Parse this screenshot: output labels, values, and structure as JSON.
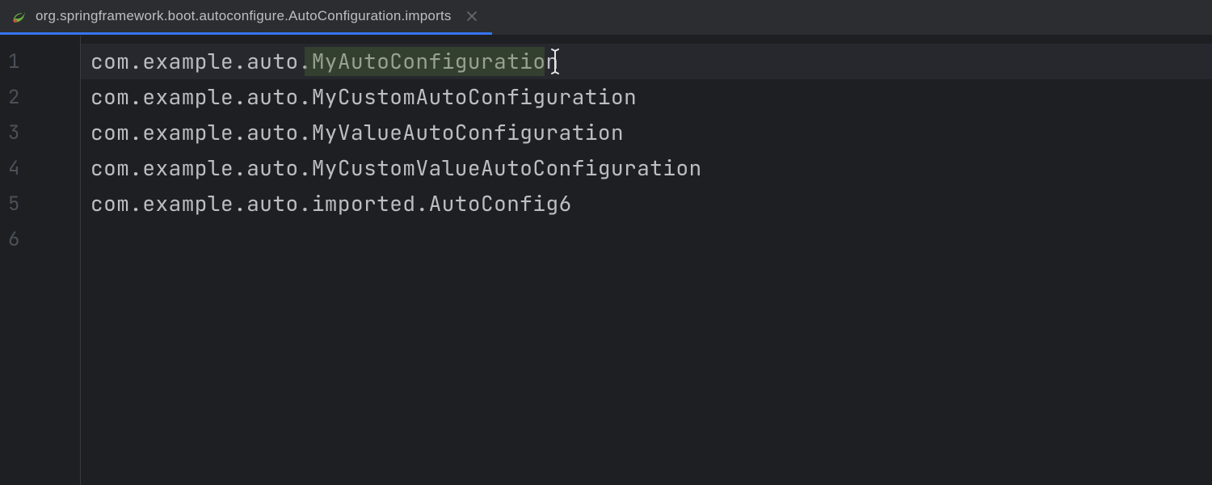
{
  "tab": {
    "title": "org.springframework.boot.autoconfigure.AutoConfiguration.imports",
    "icon": "spring-leaf-icon"
  },
  "editor": {
    "lines": [
      {
        "num": "1",
        "text": "com.example.auto.MyAutoConfiguration",
        "current": true,
        "highlight": "MyAutoConfiguration",
        "cursorAfter": true
      },
      {
        "num": "2",
        "text": "com.example.auto.MyCustomAutoConfiguration"
      },
      {
        "num": "3",
        "text": "com.example.auto.MyValueAutoConfiguration"
      },
      {
        "num": "4",
        "text": "com.example.auto.MyCustomValueAutoConfiguration"
      },
      {
        "num": "5",
        "text": "com.example.auto.imported.AutoConfig6"
      },
      {
        "num": "6",
        "text": ""
      }
    ]
  }
}
